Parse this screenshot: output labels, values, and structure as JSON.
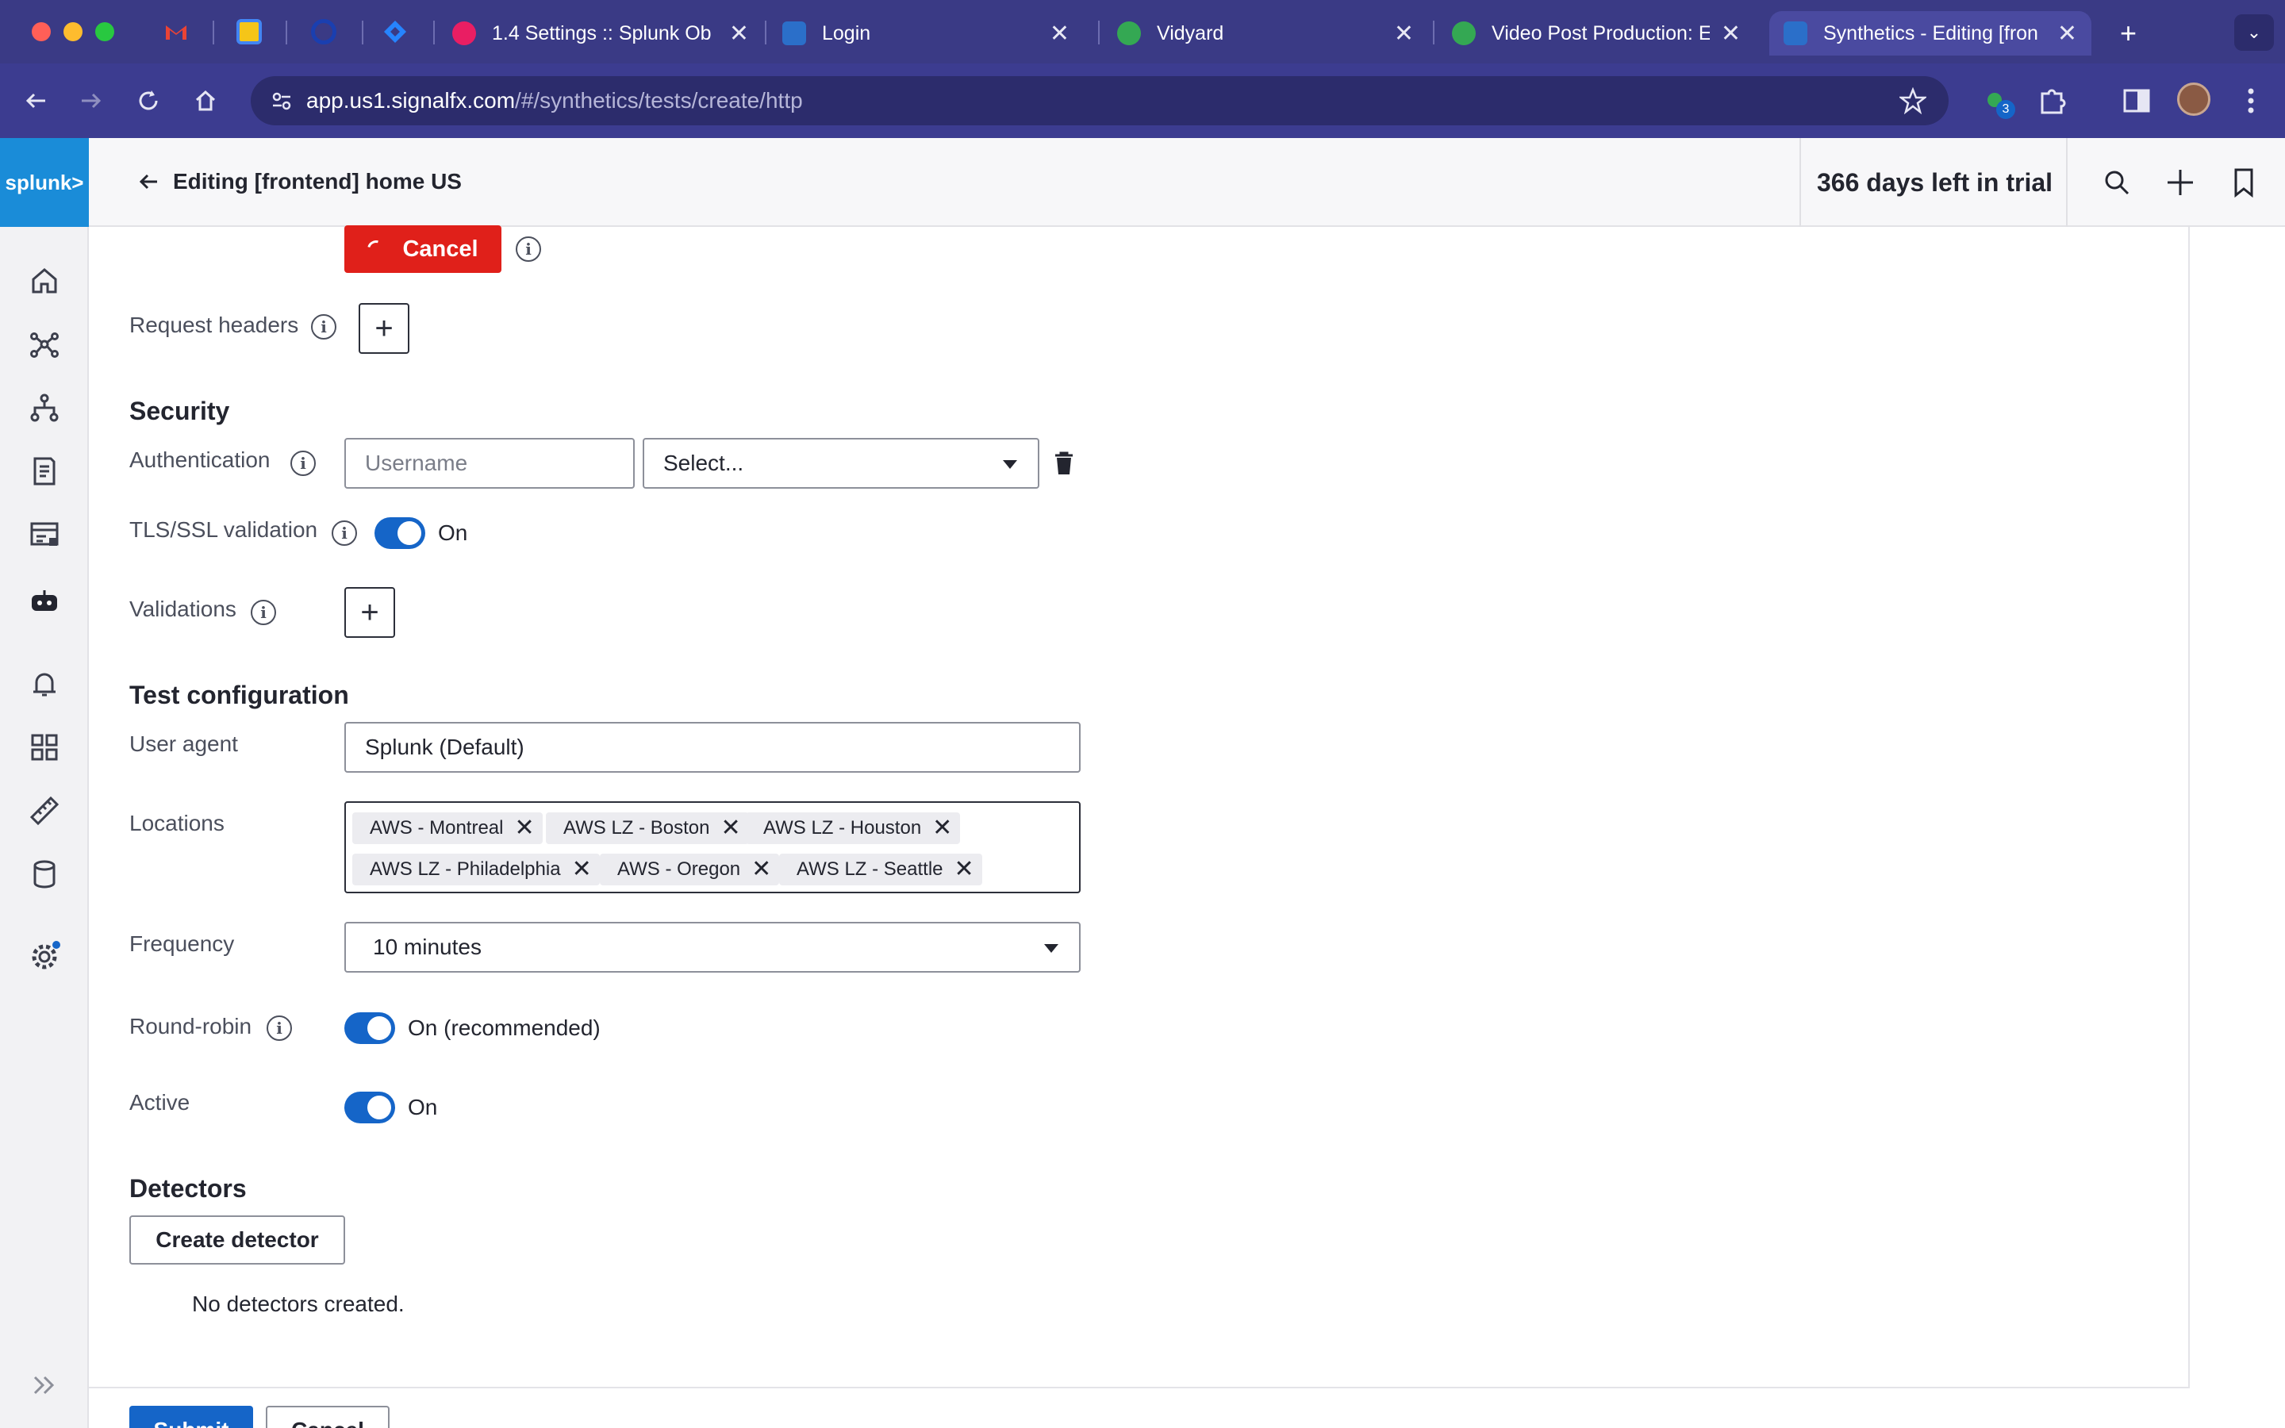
{
  "browser": {
    "tabs": [
      {
        "title": "1.4 Settings :: Splunk Ob",
        "favicon_color": "#e91e63"
      },
      {
        "title": "Login",
        "favicon_color": "#2b6fc9"
      },
      {
        "title": "Vidyard",
        "favicon_color": "#34a853"
      },
      {
        "title": "Video Post Production: E",
        "favicon_color": "#34a853"
      },
      {
        "title": "Synthetics - Editing [fron",
        "favicon_color": "#2b6fc9"
      }
    ],
    "url_host": "app.us1.signalfx.com",
    "url_path": "/#/synthetics/tests/create/http",
    "extension_badge": "3"
  },
  "app": {
    "logo_text": "splunk>",
    "page_title": "Editing [frontend] home US",
    "trial_text": "366 days left in trial"
  },
  "form": {
    "cancel_label": "Cancel",
    "request_headers_label": "Request headers",
    "security_heading": "Security",
    "authentication_label": "Authentication",
    "username_placeholder": "Username",
    "auth_select_value": "Select...",
    "tls_label": "TLS/SSL validation",
    "tls_state": "On",
    "validations_label": "Validations",
    "test_config_heading": "Test configuration",
    "user_agent_label": "User agent",
    "user_agent_value": "Splunk (Default)",
    "locations_label": "Locations",
    "locations": [
      "AWS - Montreal",
      "AWS LZ - Boston",
      "AWS LZ - Houston",
      "AWS LZ - Philadelphia",
      "AWS - Oregon",
      "AWS LZ - Seattle"
    ],
    "frequency_label": "Frequency",
    "frequency_value": "10 minutes",
    "round_robin_label": "Round-robin",
    "round_robin_state": "On (recommended)",
    "active_label": "Active",
    "active_state": "On",
    "detectors_heading": "Detectors",
    "create_detector_label": "Create detector",
    "no_detectors_text": "No detectors created.",
    "submit_label": "Submit",
    "cancel_bottom_label": "Cancel"
  },
  "colors": {
    "accent": "#1565c8",
    "danger": "#e0201a",
    "brand": "#1a8cd8"
  }
}
